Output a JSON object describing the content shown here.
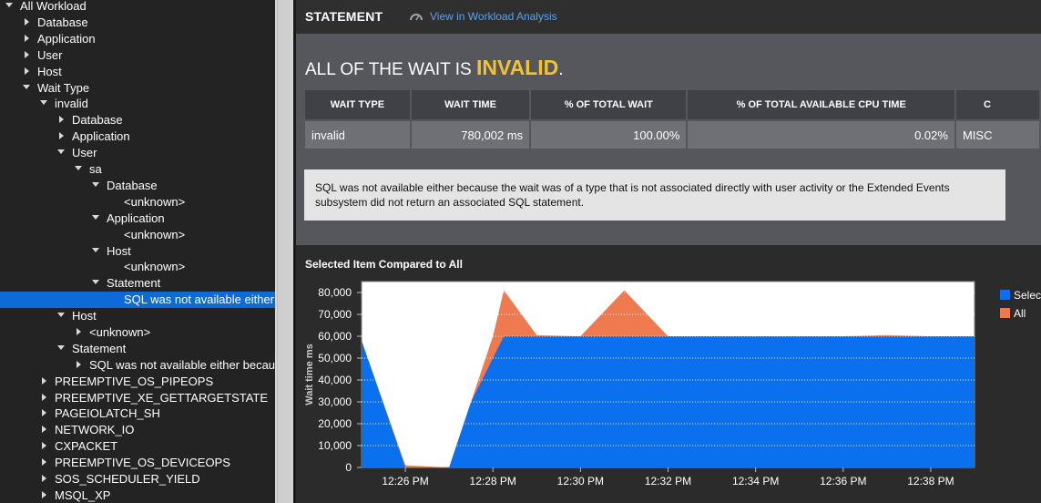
{
  "tree": [
    {
      "label": "All Workload",
      "depth": 0,
      "toggle": "down"
    },
    {
      "label": "Database",
      "depth": 1,
      "toggle": "right"
    },
    {
      "label": "Application",
      "depth": 1,
      "toggle": "right"
    },
    {
      "label": "User",
      "depth": 1,
      "toggle": "right"
    },
    {
      "label": "Host",
      "depth": 1,
      "toggle": "right"
    },
    {
      "label": "Wait Type",
      "depth": 1,
      "toggle": "down"
    },
    {
      "label": "invalid",
      "depth": 2,
      "toggle": "down"
    },
    {
      "label": "Database",
      "depth": 3,
      "toggle": "right"
    },
    {
      "label": "Application",
      "depth": 3,
      "toggle": "right"
    },
    {
      "label": "User",
      "depth": 3,
      "toggle": "down"
    },
    {
      "label": "sa",
      "depth": 4,
      "toggle": "down"
    },
    {
      "label": "Database",
      "depth": 5,
      "toggle": "down"
    },
    {
      "label": "<unknown>",
      "depth": 6,
      "toggle": "none"
    },
    {
      "label": "Application",
      "depth": 5,
      "toggle": "down"
    },
    {
      "label": "<unknown>",
      "depth": 6,
      "toggle": "none"
    },
    {
      "label": "Host",
      "depth": 5,
      "toggle": "down"
    },
    {
      "label": "<unknown>",
      "depth": 6,
      "toggle": "none"
    },
    {
      "label": "Statement",
      "depth": 5,
      "toggle": "down"
    },
    {
      "label": "SQL was not available either b",
      "depth": 6,
      "toggle": "none",
      "selected": true
    },
    {
      "label": "Host",
      "depth": 3,
      "toggle": "down"
    },
    {
      "label": "<unknown>",
      "depth": 4,
      "toggle": "right"
    },
    {
      "label": "Statement",
      "depth": 3,
      "toggle": "down"
    },
    {
      "label": "SQL was not available either becaus",
      "depth": 4,
      "toggle": "right"
    },
    {
      "label": "PREEMPTIVE_OS_PIPEOPS",
      "depth": 2,
      "toggle": "right"
    },
    {
      "label": "PREEMPTIVE_XE_GETTARGETSTATE",
      "depth": 2,
      "toggle": "right"
    },
    {
      "label": "PAGEIOLATCH_SH",
      "depth": 2,
      "toggle": "right"
    },
    {
      "label": "NETWORK_IO",
      "depth": 2,
      "toggle": "right"
    },
    {
      "label": "CXPACKET",
      "depth": 2,
      "toggle": "right"
    },
    {
      "label": "PREEMPTIVE_OS_DEVICEOPS",
      "depth": 2,
      "toggle": "right"
    },
    {
      "label": "SOS_SCHEDULER_YIELD",
      "depth": 2,
      "toggle": "right"
    },
    {
      "label": "MSQL_XP",
      "depth": 2,
      "toggle": "right"
    }
  ],
  "header": {
    "title": "STATEMENT",
    "link_label": "View in Workload Analysis"
  },
  "summary": {
    "headline_prefix": "ALL OF THE WAIT IS ",
    "headline_value": "INVALID",
    "headline_suffix": ".",
    "table": {
      "columns": [
        "WAIT TYPE",
        "WAIT TIME",
        "% OF TOTAL WAIT",
        "% OF TOTAL AVAILABLE CPU TIME",
        "C"
      ],
      "rows": [
        [
          "invalid",
          "780,002 ms",
          "100.00%",
          "0.02%",
          "MISC"
        ]
      ]
    },
    "notice": "SQL was not available either because the wait was of a type that is not associated directly with user activity or the Extended Events subsystem did not return an associated SQL statement."
  },
  "chart_data": {
    "type": "area",
    "title": "Selected Item Compared to All",
    "xlabel": "",
    "ylabel": "Wait time ms",
    "ylim": [
      0,
      85000
    ],
    "yticks": [
      0,
      10000,
      20000,
      30000,
      40000,
      50000,
      60000,
      70000,
      80000
    ],
    "ytick_labels": [
      "0",
      "10,000",
      "20,000",
      "30,000",
      "40,000",
      "50,000",
      "60,000",
      "70,000",
      "80,000"
    ],
    "xtick_labels": [
      "12:26 PM",
      "12:28 PM",
      "12:30 PM",
      "12:32 PM",
      "12:34 PM",
      "12:36 PM",
      "12:38 PM"
    ],
    "xlim_minutes_past_1225": [
      0,
      14
    ],
    "grid": true,
    "legend_position": "right",
    "series": [
      {
        "name": "Selected",
        "legend_label": "Selec",
        "color": "#0a70ee",
        "x": [
          0,
          1,
          2,
          2.5,
          3.25,
          4,
          5,
          6,
          7,
          8,
          9,
          10,
          11,
          12,
          13,
          14
        ],
        "y": [
          58000,
          0,
          0,
          30000,
          60000,
          60000,
          60000,
          60000,
          60000,
          60000,
          60000,
          60000,
          60000,
          60000,
          60000,
          60000
        ]
      },
      {
        "name": "All",
        "legend_label": "All",
        "color": "#f07a50",
        "x": [
          0,
          1,
          2,
          2.5,
          3,
          3.25,
          4,
          5,
          6,
          7,
          8,
          9,
          10,
          11,
          12,
          13,
          14
        ],
        "y": [
          58000,
          1000,
          0,
          30000,
          60000,
          81000,
          60500,
          60000,
          81000,
          60000,
          60000,
          60000,
          60000,
          60000,
          60500,
          60000,
          60000
        ]
      }
    ]
  }
}
